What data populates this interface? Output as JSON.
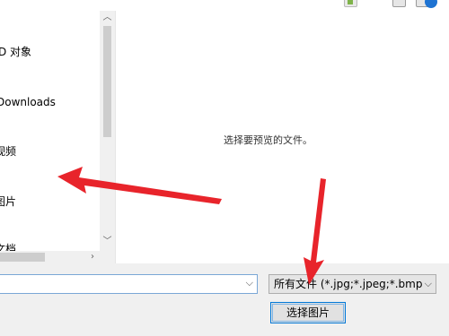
{
  "nav": {
    "items": [
      {
        "label": "D 对象"
      },
      {
        "label": "Downloads"
      },
      {
        "label": "视频"
      },
      {
        "label": "图片"
      },
      {
        "label": "文档"
      }
    ]
  },
  "preview": {
    "message": "选择要预览的文件。"
  },
  "footer": {
    "filename_value": "",
    "filetype_selected": "所有文件 (*.jpg;*.jpeg;*.bmp;*",
    "select_button_label": "选择图片"
  },
  "icons": {
    "up": "chevron-up-icon",
    "down": "chevron-down-icon",
    "right": "chevron-right-icon",
    "dropdown": "chevron-down-icon"
  },
  "colors": {
    "accent": "#0078d7",
    "annotation": "#e8242b"
  }
}
